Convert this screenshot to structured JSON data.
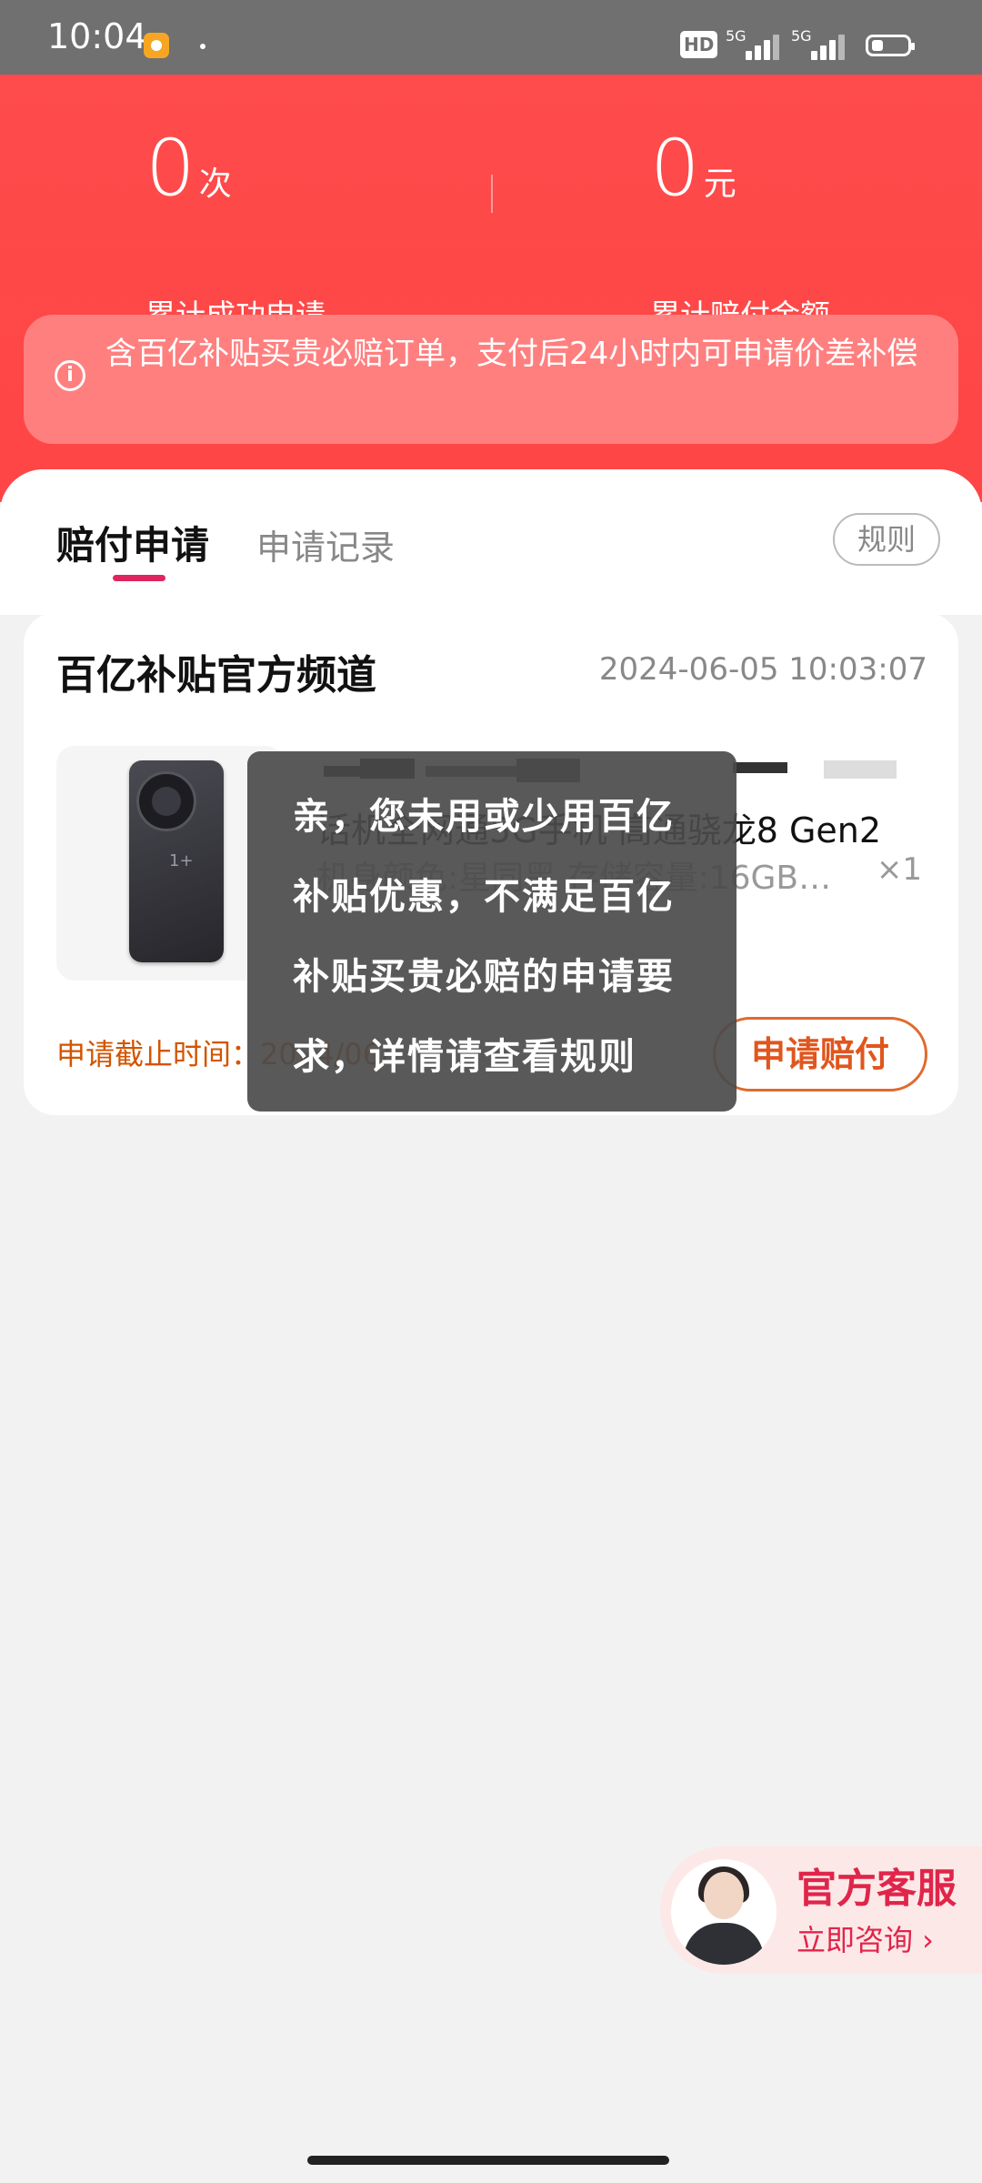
{
  "status_bar": {
    "time": "10:04",
    "network1": "5G",
    "network2": "5G",
    "hd": "HD"
  },
  "header": {
    "stats": [
      {
        "number": "0",
        "unit": "次",
        "label": "累计成功申请"
      },
      {
        "number": "0",
        "unit": "元",
        "label": "累计赔付金额"
      }
    ],
    "notice": "含百亿补贴买贵必赔订单，支付后24小时内可申请价差补偿"
  },
  "tabs": {
    "active": "赔付申请",
    "inactive": "申请记录",
    "rules_label": "规则"
  },
  "card": {
    "channel": "百亿补贴官方频道",
    "timestamp": "2024-06-05 10:03:07",
    "product_title": "话机全网通5G手机 高通骁龙8 Gen2",
    "product_spec": "机身颜色:星同黑 存储容量:16GB…",
    "quantity": "×1",
    "deadline_label": "申请截止时间：2024/06/",
    "apply_button": "申请赔付",
    "phone_logo": "1+"
  },
  "toast": {
    "message": "亲，您未用或少用百亿补贴优惠，不满足百亿补贴买贵必赔的申请要求，详情请查看规则"
  },
  "customer_service": {
    "title": "官方客服",
    "subtitle": "立即咨询 ›"
  },
  "colors": {
    "header_red": "#fe4b4b",
    "accent_pink": "#e0245e",
    "orange": "#e0561e"
  }
}
